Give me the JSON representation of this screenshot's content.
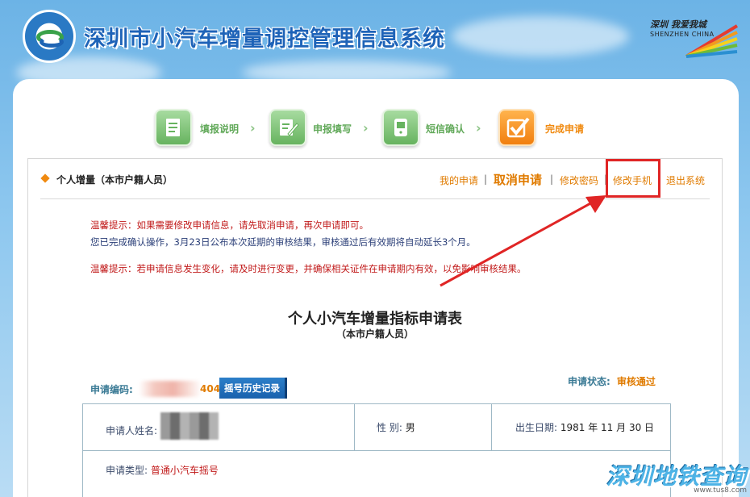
{
  "header": {
    "site_title": "深圳市小汽车增量调控管理信息系统",
    "logo_alt_text": "深圳市交通运输委员会",
    "city_logo_cn": "深圳 我爱我城",
    "city_logo_en": "SHENZHEN  CHINA"
  },
  "steps": [
    {
      "label": "填报说明",
      "icon": "document-icon",
      "state": "done"
    },
    {
      "label": "申报填写",
      "icon": "form-edit-icon",
      "state": "done"
    },
    {
      "label": "短信确认",
      "icon": "sms-phone-icon",
      "state": "done"
    },
    {
      "label": "完成申请",
      "icon": "checkmark-icon",
      "state": "current"
    }
  ],
  "panel": {
    "title": "个人增量（本市户籍人员）",
    "links": {
      "my_application": "我的申请",
      "cancel_application": "取消申请",
      "change_password": "修改密码",
      "change_phone": "修改手机",
      "logout": "退出系统",
      "separator": "|"
    }
  },
  "notices": {
    "line1": "温馨提示：如果需要修改申请信息，请先取消申请，再次申请即可。",
    "line2": "您已完成确认操作，3月23日公布本次延期的审核结果，审核通过后有效期将自动延长3个月。",
    "line3": "温馨提示：若申请信息发生变化，请及时进行变更，并确保相关证件在申请期内有效，以免影响审核结果。"
  },
  "form": {
    "title": "个人小汽车增量指标申请表",
    "subtitle": "（本市户籍人员）",
    "app_no_label": "申请编码:",
    "app_no_visible_tail": "404",
    "history_button": "摇号历史记录",
    "status_label": "申请状态:",
    "status_value": "审核通过",
    "applicant_name_label": "申请人姓名:",
    "gender_label": "性  别:",
    "gender_value": "男",
    "birth_label": "出生日期:",
    "birth_value": "1981 年 11 月 30 日",
    "type_label": "申请类型:",
    "type_value": "普通小汽车摇号"
  },
  "watermark": {
    "text": "深圳地铁查询",
    "url": "www.tus8.com"
  },
  "colors": {
    "accent_orange": "#e07b00",
    "brand_blue": "#1e63b8",
    "step_green": "#67b35f",
    "highlight_red": "#e02525"
  }
}
